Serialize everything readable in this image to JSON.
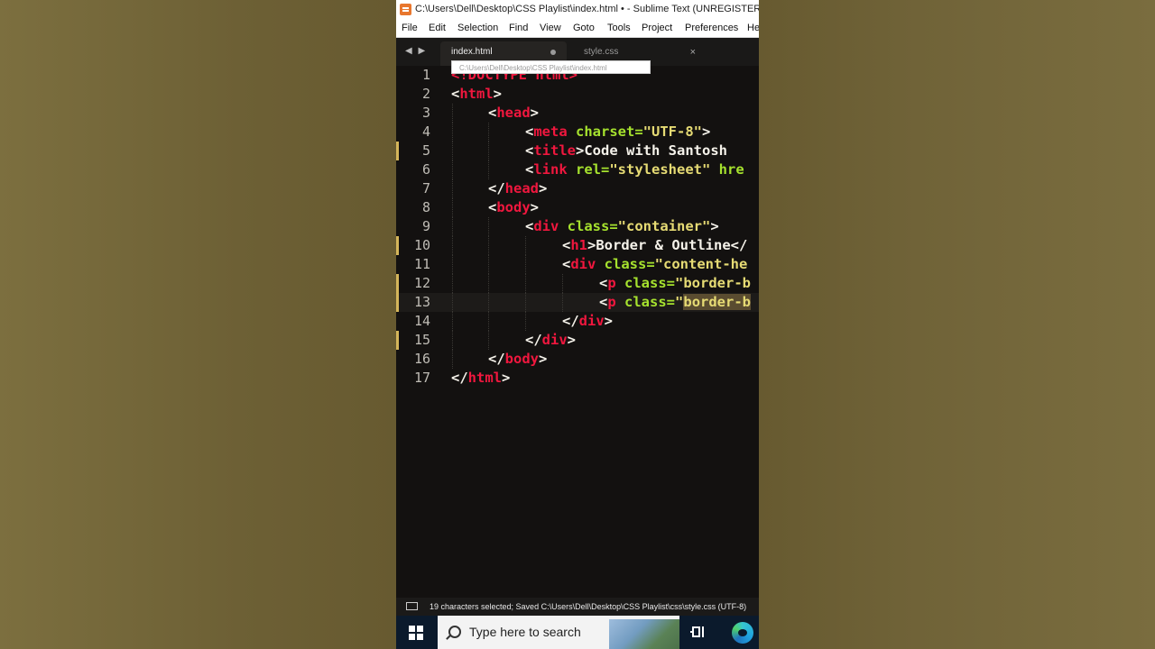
{
  "window": {
    "title": "C:\\Users\\Dell\\Desktop\\CSS Playlist\\index.html • - Sublime Text (UNREGISTERED)"
  },
  "menu": [
    "File",
    "Edit",
    "Selection",
    "Find",
    "View",
    "Goto",
    "Tools",
    "Project",
    "Preferences",
    "He"
  ],
  "tabs": {
    "arrows": "◀ ▶",
    "active": "index.html",
    "inactive": "style.css",
    "close": "×"
  },
  "tooltip": "C:\\Users\\Dell\\Desktop\\CSS Playlist\\index.html",
  "lines": [
    {
      "n": "1"
    },
    {
      "n": "2"
    },
    {
      "n": "3"
    },
    {
      "n": "4"
    },
    {
      "n": "5"
    },
    {
      "n": "6"
    },
    {
      "n": "7"
    },
    {
      "n": "8"
    },
    {
      "n": "9"
    },
    {
      "n": "10"
    },
    {
      "n": "11"
    },
    {
      "n": "12"
    },
    {
      "n": "13"
    },
    {
      "n": "14"
    },
    {
      "n": "15"
    },
    {
      "n": "16"
    },
    {
      "n": "17"
    }
  ],
  "code": {
    "l1": "<!DOCTYPE html>",
    "l2": [
      "<",
      "html",
      ">"
    ],
    "l3": [
      "<",
      "head",
      ">"
    ],
    "l4": [
      "<",
      "meta",
      " charset=",
      "\"UTF-8\"",
      ">"
    ],
    "l5": [
      "<",
      "title",
      ">Code with Santosh"
    ],
    "l6": [
      "<",
      "link",
      " rel=",
      "\"stylesheet\"",
      " hre"
    ],
    "l7": [
      "</",
      "head",
      ">"
    ],
    "l8": [
      "<",
      "body",
      ">"
    ],
    "l9": [
      "<",
      "div",
      " class=",
      "\"container\"",
      ">"
    ],
    "l10": [
      "<",
      "h1",
      ">Border & Outline</"
    ],
    "l11": [
      "<",
      "div",
      " class=",
      "\"content-he"
    ],
    "l12": [
      "<",
      "p",
      " class=",
      "\"border-b"
    ],
    "l13": [
      "<",
      "p",
      " class=",
      "\"",
      "border-b"
    ],
    "l14": [
      "</",
      "div",
      ">"
    ],
    "l15": [
      "</",
      "div",
      ">"
    ],
    "l16": [
      "</",
      "body",
      ">"
    ],
    "l17": [
      "</",
      "html",
      ">"
    ]
  },
  "status": "19 characters selected; Saved C:\\Users\\Dell\\Desktop\\CSS Playlist\\css\\style.css (UTF-8)",
  "taskbar": {
    "search_placeholder": "Type here to search"
  }
}
